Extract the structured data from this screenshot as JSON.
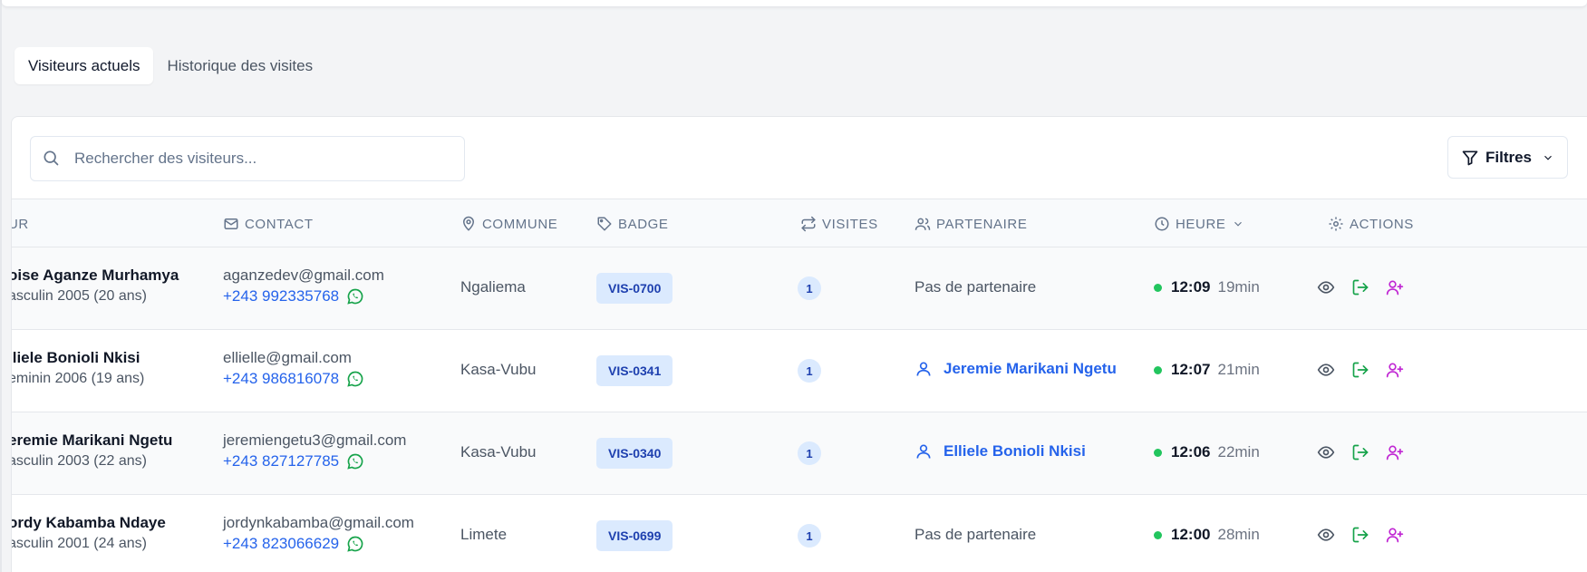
{
  "tabs": [
    {
      "label": "Visiteurs actuels",
      "active": true
    },
    {
      "label": "Historique des visites",
      "active": false
    }
  ],
  "search": {
    "placeholder": "Rechercher des visiteurs..."
  },
  "filters": {
    "label": "Filtres"
  },
  "columns": {
    "visitor": "UR",
    "contact": "CONTACT",
    "commune": "COMMUNE",
    "badge": "BADGE",
    "visits": "VISITES",
    "partner": "PARTENAIRE",
    "time": "HEURE",
    "actions": "ACTIONS"
  },
  "rows": [
    {
      "name": "oise Aganze Murhamya",
      "details": "asculin 2005 (20 ans)",
      "email": "aganzedev@gmail.com",
      "phone": "+243 992335768",
      "commune": "Ngaliema",
      "badge": "VIS-0700",
      "visits": "1",
      "partner": "Pas de partenaire",
      "partner_linked": false,
      "time": "12:09",
      "elapsed": "19min"
    },
    {
      "name": "lliele Bonioli Nkisi",
      "details": "eminin 2006 (19 ans)",
      "email": "ellielle@gmail.com",
      "phone": "+243 986816078",
      "commune": "Kasa-Vubu",
      "badge": "VIS-0341",
      "visits": "1",
      "partner": "Jeremie Marikani Ngetu",
      "partner_linked": true,
      "time": "12:07",
      "elapsed": "21min"
    },
    {
      "name": "eremie Marikani Ngetu",
      "details": "asculin 2003 (22 ans)",
      "email": "jeremiengetu3@gmail.com",
      "phone": "+243 827127785",
      "commune": "Kasa-Vubu",
      "badge": "VIS-0340",
      "visits": "1",
      "partner": "Elliele Bonioli Nkisi",
      "partner_linked": true,
      "time": "12:06",
      "elapsed": "22min"
    },
    {
      "name": "ordy Kabamba Ndaye",
      "details": "asculin 2001 (24 ans)",
      "email": "jordynkabamba@gmail.com",
      "phone": "+243 823066629",
      "commune": "Limete",
      "badge": "VIS-0699",
      "visits": "1",
      "partner": "Pas de partenaire",
      "partner_linked": false,
      "time": "12:00",
      "elapsed": "28min"
    }
  ],
  "colors": {
    "link": "#2563eb",
    "badge_bg": "#dbeafe",
    "online_dot": "#22c55e",
    "whatsapp": "#16a34a",
    "checkout": "#16a34a",
    "add_partner": "#c026d3"
  }
}
